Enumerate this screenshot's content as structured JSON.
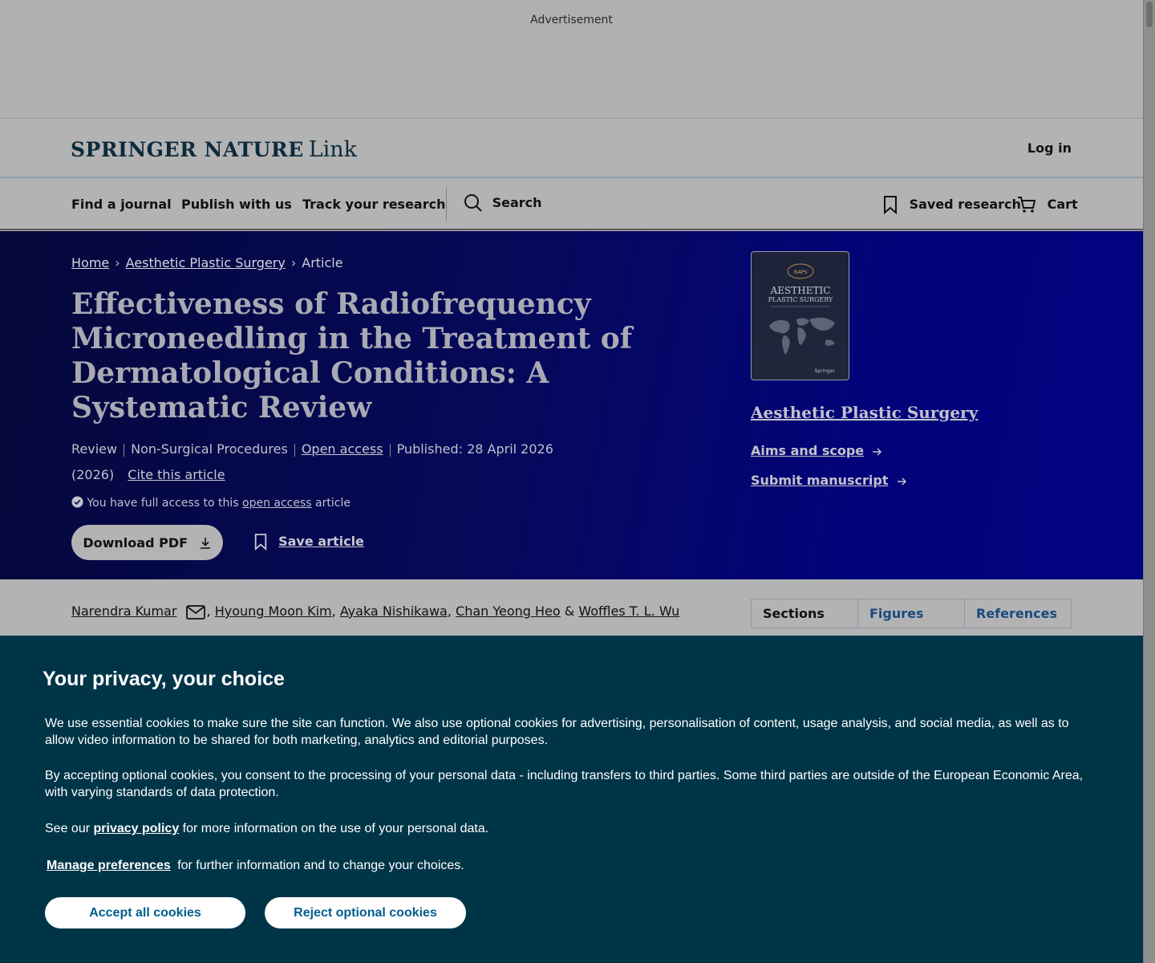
{
  "ad": {
    "label": "Advertisement"
  },
  "header": {
    "logo_main": "SPRINGER NATURE",
    "logo_sub": "Link",
    "login": "Log in"
  },
  "nav": {
    "find_journal": "Find a journal",
    "publish": "Publish with us",
    "track": "Track your research",
    "search": "Search",
    "saved": "Saved research",
    "cart": "Cart"
  },
  "breadcrumb": {
    "home": "Home",
    "journal": "Aesthetic Plastic Surgery",
    "current": "Article"
  },
  "article": {
    "title": "Effectiveness of Radiofrequency Microneedling in the Treatment of Dermatological Conditions: A Systematic Review",
    "type": "Review",
    "category": "Non-Surgical Procedures",
    "open_access": "Open access",
    "published": "Published: 28 April 2026",
    "year": "(2026)",
    "cite": "Cite this article",
    "access_prefix": "You have full access to this",
    "access_link": "open access",
    "access_suffix": "article",
    "download_pdf": "Download PDF",
    "save_article": "Save article"
  },
  "journal_panel": {
    "cover_badge": "ISAPS",
    "cover_title_1": "AESTHETIC",
    "cover_title_2": "PLASTIC SURGERY",
    "cover_publisher": "Springer",
    "name": "Aesthetic Plastic Surgery",
    "aims": "Aims and scope",
    "submit": "Submit manuscript"
  },
  "authors": [
    "Narendra Kumar",
    "Hyoung Moon Kim",
    "Ayaka Nishikawa",
    "Chan Yeong Heo",
    "Woffles T. L. Wu"
  ],
  "tabs": [
    "Sections",
    "Figures",
    "References"
  ],
  "cookie": {
    "title": "Your privacy, your choice",
    "p1": "We use essential cookies to make sure the site can function. We also use optional cookies for advertising, personalisation of content, usage analysis, and social media, as well as to allow video information to be shared for both marketing, analytics and editorial purposes.",
    "p2": "By accepting optional cookies, you consent to the processing of your personal data - including transfers to third parties. Some third parties are outside of the European Economic Area, with varying standards of data protection.",
    "p3_prefix": "See our",
    "p3_link": "privacy policy",
    "p3_suffix": "for more information on the use of your personal data.",
    "p4_link": "Manage preferences",
    "p4_suffix": "for further information and to change your choices.",
    "accept": "Accept all cookies",
    "reject": "Reject optional cookies"
  },
  "colors": {
    "hero_dark": "#05083a",
    "hero_blue": "#020380",
    "cookie_bg": "#003548",
    "button_text": "#025e8d"
  }
}
